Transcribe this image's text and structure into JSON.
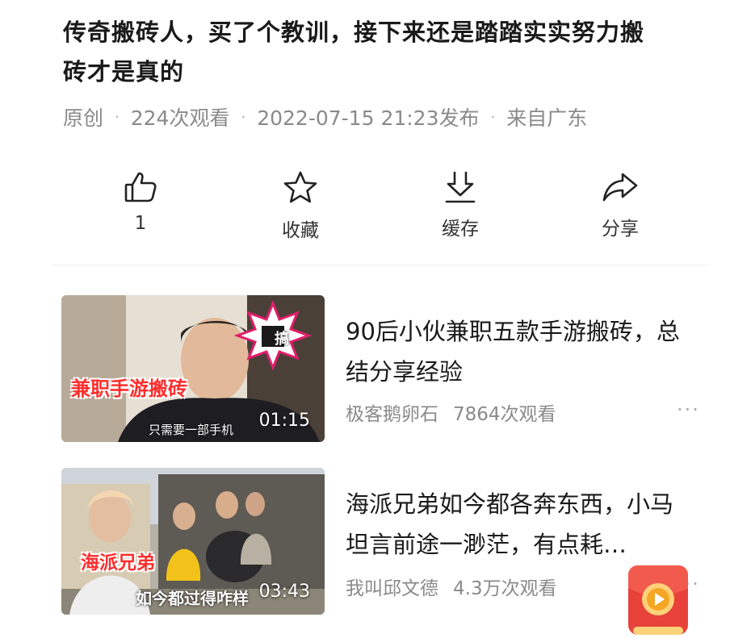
{
  "post": {
    "title": "传奇搬砖人，买了个教训，接下来还是踏踏实实努力搬砖才是真的",
    "meta": [
      "原创",
      "224次观看",
      "2022-07-15 21:23发布",
      "来自广东"
    ]
  },
  "actions": [
    {
      "icon": "thumb-up-icon",
      "label": "1"
    },
    {
      "icon": "star-icon",
      "label": "收藏"
    },
    {
      "icon": "download-icon",
      "label": "缓存"
    },
    {
      "icon": "share-icon",
      "label": "分享"
    }
  ],
  "videos": [
    {
      "title": "90后小伙兼职五款手游搬砖，总结分享经验",
      "author": "极客鹅卵石",
      "views": "7864次观看",
      "duration": "01:15",
      "overlay_caption": "兼职手游搬砖",
      "overlay_subtitle": "只需要一部手机",
      "badge_text": "搞"
    },
    {
      "title": "海派兄弟如今都各奔东西，小马坦言前途一渺茫，有点耗…",
      "author": "我叫邱文德",
      "views": "4.3万次观看",
      "duration": "03:43",
      "overlay_caption": "海派兄弟",
      "overlay_subtitle": "如今都过得咋样"
    }
  ],
  "more_label": "···",
  "colors": {
    "accent_red": "#ff2e2e",
    "meta_gray": "#8a8a8a"
  }
}
